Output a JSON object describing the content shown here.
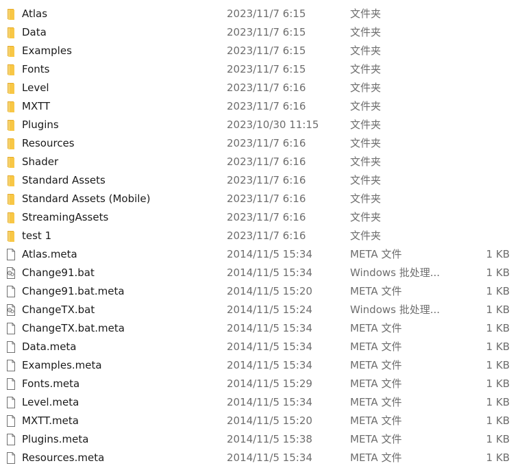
{
  "colors": {
    "folder_yellow": "#f8c746",
    "folder_shade": "#e4a92a",
    "text_primary": "#1a1a1a",
    "text_secondary": "#6d6d6d"
  },
  "rows": [
    {
      "icon": "folder-icon",
      "name": "Atlas",
      "date": "2023/11/7 6:15",
      "type": "文件夹",
      "size": ""
    },
    {
      "icon": "folder-icon",
      "name": "Data",
      "date": "2023/11/7 6:15",
      "type": "文件夹",
      "size": ""
    },
    {
      "icon": "folder-icon",
      "name": "Examples",
      "date": "2023/11/7 6:15",
      "type": "文件夹",
      "size": ""
    },
    {
      "icon": "folder-icon",
      "name": "Fonts",
      "date": "2023/11/7 6:15",
      "type": "文件夹",
      "size": ""
    },
    {
      "icon": "folder-icon",
      "name": "Level",
      "date": "2023/11/7 6:16",
      "type": "文件夹",
      "size": ""
    },
    {
      "icon": "folder-icon",
      "name": "MXTT",
      "date": "2023/11/7 6:16",
      "type": "文件夹",
      "size": ""
    },
    {
      "icon": "folder-icon",
      "name": "Plugins",
      "date": "2023/10/30 11:15",
      "type": "文件夹",
      "size": ""
    },
    {
      "icon": "folder-icon",
      "name": "Resources",
      "date": "2023/11/7 6:16",
      "type": "文件夹",
      "size": ""
    },
    {
      "icon": "folder-icon",
      "name": "Shader",
      "date": "2023/11/7 6:16",
      "type": "文件夹",
      "size": ""
    },
    {
      "icon": "folder-icon",
      "name": "Standard Assets",
      "date": "2023/11/7 6:16",
      "type": "文件夹",
      "size": ""
    },
    {
      "icon": "folder-icon",
      "name": "Standard Assets (Mobile)",
      "date": "2023/11/7 6:16",
      "type": "文件夹",
      "size": ""
    },
    {
      "icon": "folder-icon",
      "name": "StreamingAssets",
      "date": "2023/11/7 6:16",
      "type": "文件夹",
      "size": ""
    },
    {
      "icon": "folder-icon",
      "name": "test 1",
      "date": "2023/11/7 6:16",
      "type": "文件夹",
      "size": ""
    },
    {
      "icon": "file-icon",
      "name": "Atlas.meta",
      "date": "2014/11/5 15:34",
      "type": "META 文件",
      "size": "1 KB"
    },
    {
      "icon": "batch-file-icon",
      "name": "Change91.bat",
      "date": "2014/11/5 15:34",
      "type": "Windows 批处理...",
      "size": "1 KB"
    },
    {
      "icon": "file-icon",
      "name": "Change91.bat.meta",
      "date": "2014/11/5 15:20",
      "type": "META 文件",
      "size": "1 KB"
    },
    {
      "icon": "batch-file-icon",
      "name": "ChangeTX.bat",
      "date": "2014/11/5 15:24",
      "type": "Windows 批处理...",
      "size": "1 KB"
    },
    {
      "icon": "file-icon",
      "name": "ChangeTX.bat.meta",
      "date": "2014/11/5 15:34",
      "type": "META 文件",
      "size": "1 KB"
    },
    {
      "icon": "file-icon",
      "name": "Data.meta",
      "date": "2014/11/5 15:34",
      "type": "META 文件",
      "size": "1 KB"
    },
    {
      "icon": "file-icon",
      "name": "Examples.meta",
      "date": "2014/11/5 15:34",
      "type": "META 文件",
      "size": "1 KB"
    },
    {
      "icon": "file-icon",
      "name": "Fonts.meta",
      "date": "2014/11/5 15:29",
      "type": "META 文件",
      "size": "1 KB"
    },
    {
      "icon": "file-icon",
      "name": "Level.meta",
      "date": "2014/11/5 15:34",
      "type": "META 文件",
      "size": "1 KB"
    },
    {
      "icon": "file-icon",
      "name": "MXTT.meta",
      "date": "2014/11/5 15:20",
      "type": "META 文件",
      "size": "1 KB"
    },
    {
      "icon": "file-icon",
      "name": "Plugins.meta",
      "date": "2014/11/5 15:38",
      "type": "META 文件",
      "size": "1 KB"
    },
    {
      "icon": "file-icon",
      "name": "Resources.meta",
      "date": "2014/11/5 15:34",
      "type": "META 文件",
      "size": "1 KB"
    }
  ]
}
